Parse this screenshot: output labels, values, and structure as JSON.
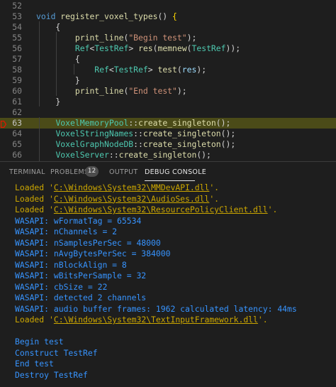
{
  "editor": {
    "lines": [
      {
        "num": "52",
        "current": false,
        "tokens": []
      },
      {
        "num": "53",
        "current": false,
        "tokens": [
          {
            "t": "void",
            "c": "kw"
          },
          {
            "t": " ",
            "c": "p"
          },
          {
            "t": "register_voxel_types",
            "c": "fn"
          },
          {
            "t": "() ",
            "c": "p"
          },
          {
            "t": "{",
            "c": "brace"
          }
        ]
      },
      {
        "num": "54",
        "current": false,
        "tokens": [
          {
            "t": "    {",
            "c": "p"
          }
        ]
      },
      {
        "num": "55",
        "current": false,
        "tokens": [
          {
            "t": "        ",
            "c": "p"
          },
          {
            "t": "print_line",
            "c": "fn"
          },
          {
            "t": "(",
            "c": "p"
          },
          {
            "t": "\"Begin test\"",
            "c": "str"
          },
          {
            "t": ");",
            "c": "p"
          }
        ]
      },
      {
        "num": "56",
        "current": false,
        "tokens": [
          {
            "t": "        ",
            "c": "p"
          },
          {
            "t": "Ref",
            "c": "type"
          },
          {
            "t": "<",
            "c": "p"
          },
          {
            "t": "TestRef",
            "c": "type"
          },
          {
            "t": "> ",
            "c": "p"
          },
          {
            "t": "res",
            "c": "fn"
          },
          {
            "t": "(",
            "c": "p"
          },
          {
            "t": "memnew",
            "c": "fn"
          },
          {
            "t": "(",
            "c": "p"
          },
          {
            "t": "TestRef",
            "c": "type"
          },
          {
            "t": "));",
            "c": "p"
          }
        ]
      },
      {
        "num": "57",
        "current": false,
        "tokens": [
          {
            "t": "        {",
            "c": "p"
          }
        ]
      },
      {
        "num": "58",
        "current": false,
        "tokens": [
          {
            "t": "            ",
            "c": "p"
          },
          {
            "t": "Ref",
            "c": "type"
          },
          {
            "t": "<",
            "c": "p"
          },
          {
            "t": "TestRef",
            "c": "type"
          },
          {
            "t": "> ",
            "c": "p"
          },
          {
            "t": "test",
            "c": "fn"
          },
          {
            "t": "(",
            "c": "p"
          },
          {
            "t": "res",
            "c": "var"
          },
          {
            "t": ");",
            "c": "p"
          }
        ]
      },
      {
        "num": "59",
        "current": false,
        "tokens": [
          {
            "t": "        }",
            "c": "p"
          }
        ]
      },
      {
        "num": "60",
        "current": false,
        "tokens": [
          {
            "t": "        ",
            "c": "p"
          },
          {
            "t": "print_line",
            "c": "fn"
          },
          {
            "t": "(",
            "c": "p"
          },
          {
            "t": "\"End test\"",
            "c": "str"
          },
          {
            "t": ");",
            "c": "p"
          }
        ]
      },
      {
        "num": "61",
        "current": false,
        "tokens": [
          {
            "t": "    }",
            "c": "p"
          }
        ]
      },
      {
        "num": "62",
        "current": false,
        "tokens": []
      },
      {
        "num": "63",
        "current": true,
        "tokens": [
          {
            "t": "    ",
            "c": "p"
          },
          {
            "t": "VoxelMemoryPool",
            "c": "type"
          },
          {
            "t": "::",
            "c": "p"
          },
          {
            "t": "create_singleton",
            "c": "fn"
          },
          {
            "t": "();",
            "c": "p"
          }
        ]
      },
      {
        "num": "64",
        "current": false,
        "tokens": [
          {
            "t": "    ",
            "c": "p"
          },
          {
            "t": "VoxelStringNames",
            "c": "type"
          },
          {
            "t": "::",
            "c": "p"
          },
          {
            "t": "create_singleton",
            "c": "fn"
          },
          {
            "t": "();",
            "c": "p"
          }
        ]
      },
      {
        "num": "65",
        "current": false,
        "tokens": [
          {
            "t": "    ",
            "c": "p"
          },
          {
            "t": "VoxelGraphNodeDB",
            "c": "type"
          },
          {
            "t": "::",
            "c": "p"
          },
          {
            "t": "create_singleton",
            "c": "fn"
          },
          {
            "t": "();",
            "c": "p"
          }
        ]
      },
      {
        "num": "66",
        "current": false,
        "tokens": [
          {
            "t": "    ",
            "c": "p"
          },
          {
            "t": "VoxelServer",
            "c": "type"
          },
          {
            "t": "::",
            "c": "p"
          },
          {
            "t": "create_singleton",
            "c": "fn"
          },
          {
            "t": "();",
            "c": "p"
          }
        ]
      }
    ]
  },
  "panel": {
    "tabs": {
      "terminal": "TERMINAL",
      "problems": "PROBLEMS",
      "problems_count": "12",
      "output": "OUTPUT",
      "debug_console": "DEBUG CONSOLE"
    }
  },
  "console": {
    "lines": [
      {
        "kind": "loaded",
        "prefix": "Loaded '",
        "path": "C:\\Windows\\System32\\MMDevAPI.dll",
        "suffix": "'."
      },
      {
        "kind": "loaded",
        "prefix": "Loaded '",
        "path": "C:\\Windows\\System32\\AudioSes.dll",
        "suffix": "'."
      },
      {
        "kind": "loaded",
        "prefix": "Loaded '",
        "path": "C:\\Windows\\System32\\ResourcePolicyClient.dll",
        "suffix": "'."
      },
      {
        "kind": "out",
        "text": "WASAPI: wFormatTag = 65534"
      },
      {
        "kind": "out",
        "text": "WASAPI: nChannels = 2"
      },
      {
        "kind": "out",
        "text": "WASAPI: nSamplesPerSec = 48000"
      },
      {
        "kind": "out",
        "text": "WASAPI: nAvgBytesPerSec = 384000"
      },
      {
        "kind": "out",
        "text": "WASAPI: nBlockAlign = 8"
      },
      {
        "kind": "out",
        "text": "WASAPI: wBitsPerSample = 32"
      },
      {
        "kind": "out",
        "text": "WASAPI: cbSize = 22"
      },
      {
        "kind": "out",
        "text": "WASAPI: detected 2 channels"
      },
      {
        "kind": "out",
        "text": "WASAPI: audio buffer frames: 1962 calculated latency: 44ms"
      },
      {
        "kind": "loaded",
        "prefix": "Loaded '",
        "path": "C:\\Windows\\System32\\TextInputFramework.dll",
        "suffix": "'."
      },
      {
        "kind": "blank",
        "text": ""
      },
      {
        "kind": "out",
        "text": "Begin test"
      },
      {
        "kind": "out",
        "text": "Construct TestRef"
      },
      {
        "kind": "out",
        "text": "End test"
      },
      {
        "kind": "out",
        "text": "Destroy TestRef"
      }
    ]
  }
}
